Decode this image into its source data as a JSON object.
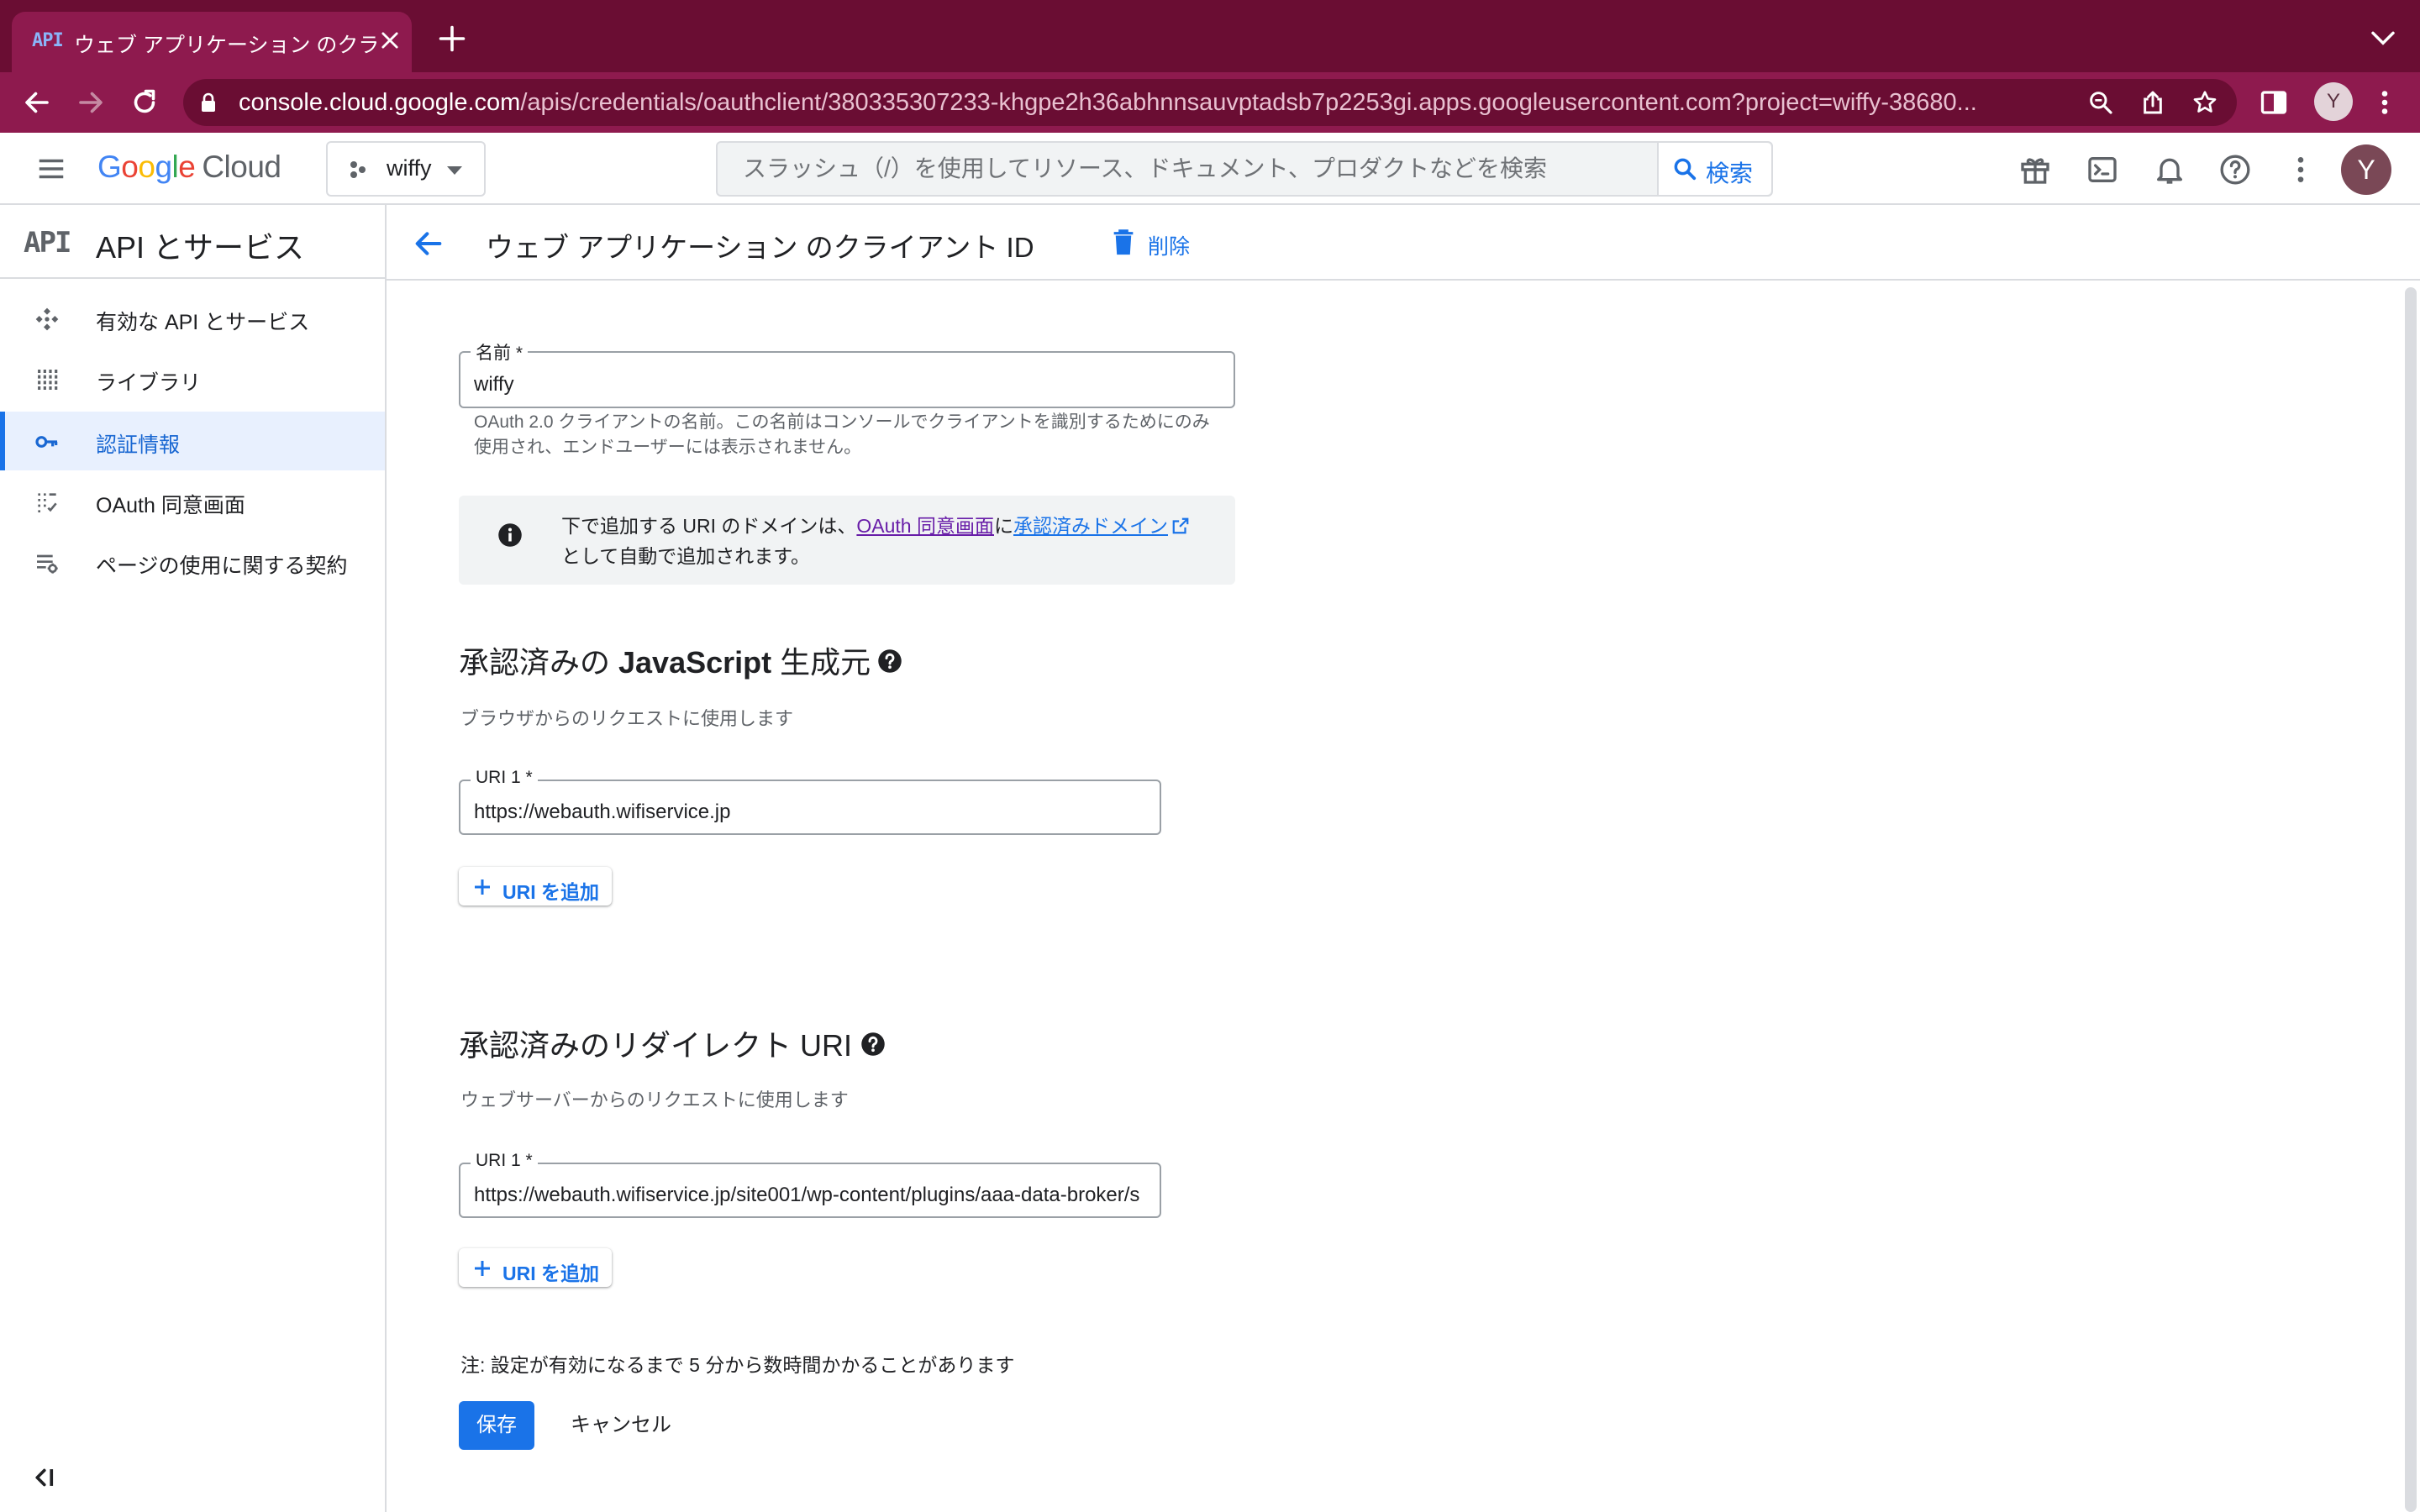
{
  "browser": {
    "tab": {
      "favicon_text": "API",
      "title": "ウェブ アプリケーション のクライ"
    },
    "url": {
      "domain": "console.cloud.google.com",
      "path": "/apis/credentials/oauthclient/380335307233-khgpe2h36abhnnsauvptadsb7p2253gi.apps.googleusercontent.com?project=wiffy-38680..."
    },
    "profile_initial": "Y",
    "theme_color": "#8e1a4e"
  },
  "header": {
    "logo": {
      "g1": "G",
      "g2": "o",
      "g3": "o",
      "g4": "g",
      "g5": "l",
      "g6": "e",
      "cloud": "Cloud"
    },
    "project_name": "wiffy",
    "search_placeholder": "スラッシュ（/）を使用してリソース、ドキュメント、プロダクトなどを検索",
    "search_button": "検索",
    "avatar_initial": "Y",
    "icons": [
      "gift-icon",
      "terminal-icon",
      "bell-icon",
      "help-icon",
      "more-vert-icon"
    ]
  },
  "sidebar": {
    "badge": "API",
    "title": "API とサービス",
    "items": [
      {
        "label": "有効な API とサービス",
        "icon": "enabled-apis-icon",
        "active": false
      },
      {
        "label": "ライブラリ",
        "icon": "library-icon",
        "active": false
      },
      {
        "label": "認証情報",
        "icon": "key-icon",
        "active": true
      },
      {
        "label": "OAuth 同意画面",
        "icon": "consent-screen-icon",
        "active": false
      },
      {
        "label": "ページの使用に関する契約",
        "icon": "page-usage-icon",
        "active": false
      }
    ]
  },
  "page": {
    "title": "ウェブ アプリケーション のクライアント ID",
    "delete_label": "削除"
  },
  "form": {
    "name": {
      "label": "名前 *",
      "value": "wiffy",
      "help": "OAuth 2.0 クライアントの名前。この名前はコンソールでクライアントを識別するためにのみ使用され、エンドユーザーには表示されません。"
    },
    "info": {
      "text_before": "下で追加する URI のドメインは、",
      "link_consent": "OAuth 同意画面",
      "text_mid": "に",
      "link_domains": "承認済みドメイン",
      "text_after": "として自動で追加されます。"
    },
    "js_origins": {
      "title_prefix": "承認済みの ",
      "title_bold": "JavaScript",
      "title_suffix": " 生成元",
      "subtitle": "ブラウザからのリクエストに使用します",
      "uri_label": "URI 1 *",
      "uri_value": "https://webauth.wifiservice.jp",
      "add_button": "URI を追加"
    },
    "redirect_uris": {
      "title": "承認済みのリダイレクト URI",
      "subtitle": "ウェブサーバーからのリクエストに使用します",
      "uri_label": "URI 1 *",
      "uri_value": "https://webauth.wifiservice.jp/site001/wp-content/plugins/aaa-data-broker/s",
      "add_button": "URI を追加"
    },
    "note": "注: 設定が有効になるまで 5 分から数時間かかることがあります",
    "save_button": "保存",
    "cancel_button": "キャンセル"
  },
  "colors": {
    "primary": "#1a73e8",
    "active_nav_bg": "#e8f0fe",
    "link_visited": "#681da8"
  }
}
